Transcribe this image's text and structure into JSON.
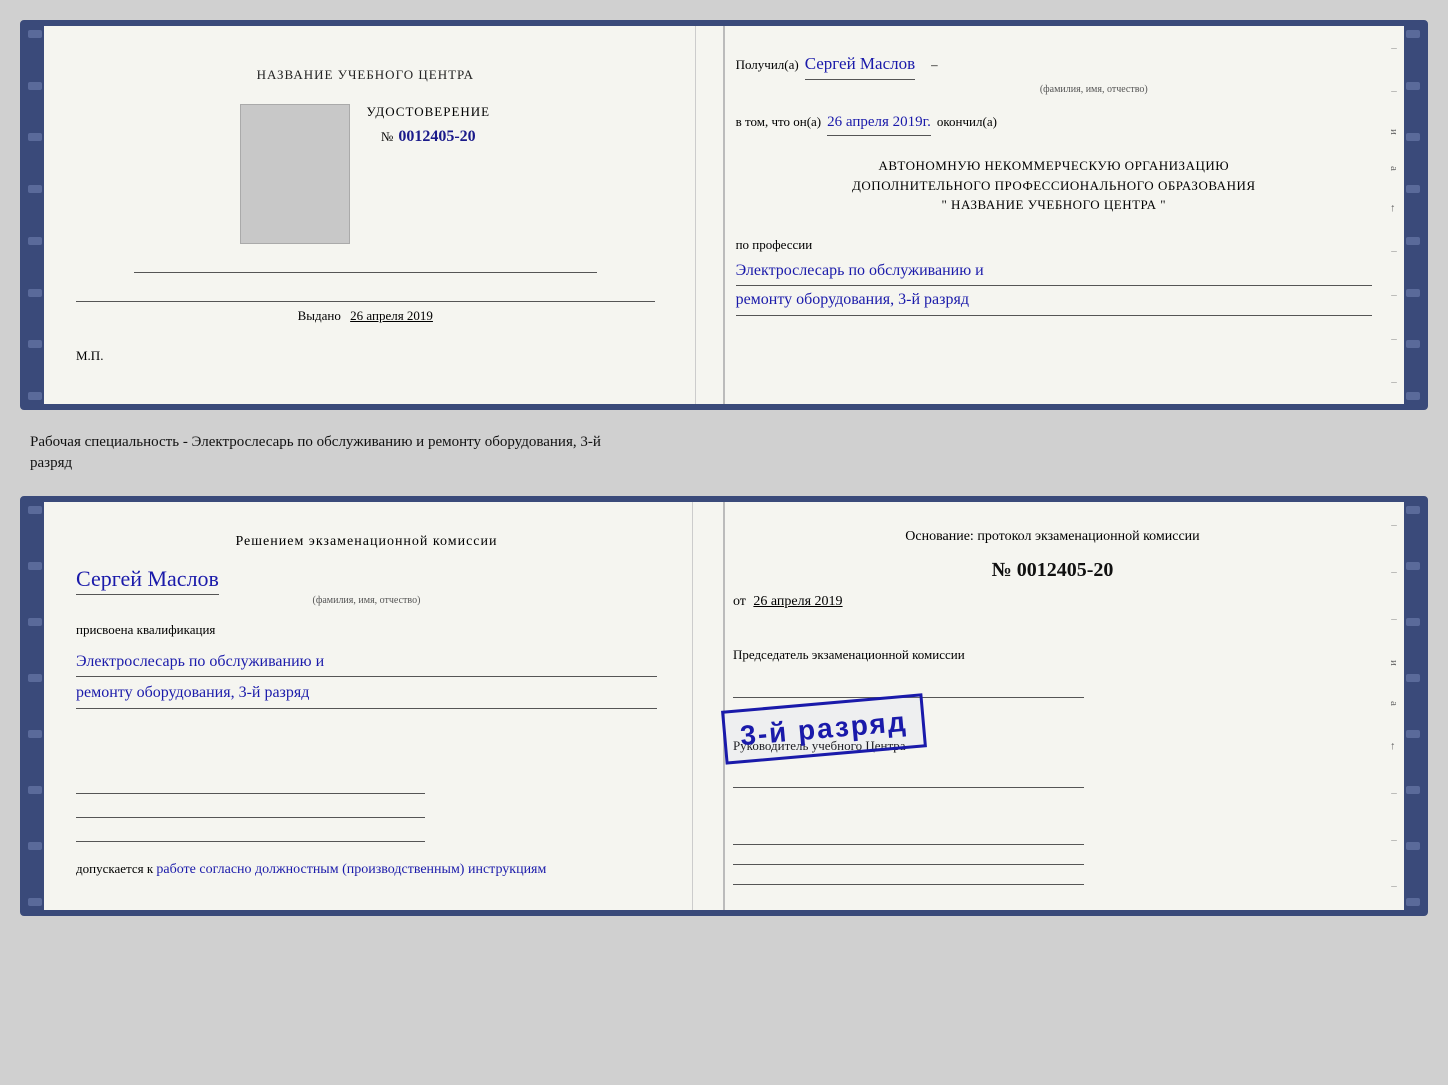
{
  "top_cert": {
    "left": {
      "training_center_label": "НАЗВАНИЕ УЧЕБНОГО ЦЕНТРА",
      "doc_type": "УДОСТОВЕРЕНИЕ",
      "doc_number_prefix": "№",
      "doc_number": "0012405-20",
      "issued_label": "Выдано",
      "issued_date": "26 апреля 2019",
      "mp_label": "М.П."
    },
    "right": {
      "received_label": "Получил(а)",
      "recipient_name": "Сергей Маслов",
      "fio_hint": "(фамилия, имя, отчество)",
      "in_that_label": "в том, что он(а)",
      "completion_date": "26 апреля 2019г.",
      "finished_label": "окончил(а)",
      "org_line1": "АВТОНОМНУЮ НЕКОММЕРЧЕСКУЮ ОРГАНИЗАЦИЮ",
      "org_line2": "ДОПОЛНИТЕЛЬНОГО ПРОФЕССИОНАЛЬНОГО ОБРАЗОВАНИЯ",
      "org_name": "\"   НАЗВАНИЕ УЧЕБНОГО ЦЕНТРА   \"",
      "profession_label": "по профессии",
      "profession_line1": "Электрослесарь по обслуживанию и",
      "profession_line2": "ремонту оборудования, 3-й разряд"
    }
  },
  "between_text": {
    "line1": "Рабочая специальность - Электрослесарь по обслуживанию и ремонту оборудования, 3-й",
    "line2": "разряд"
  },
  "bottom_cert": {
    "left": {
      "decision_title": "Решением экзаменационной комиссии",
      "person_name": "Сергей Маслов",
      "fio_hint": "(фамилия, имя, отчество)",
      "assigned_label": "присвоена квалификация",
      "qualification_line1": "Электрослесарь по обслуживанию и",
      "qualification_line2": "ремонту оборудования, 3-й разряд",
      "admits_prefix": "допускается к",
      "admits_text": "работе согласно должностным (производственным) инструкциям"
    },
    "right": {
      "basis_label": "Основание: протокол экзаменационной комиссии",
      "protocol_prefix": "№",
      "protocol_number": "0012405-20",
      "date_prefix": "от",
      "protocol_date": "26 апреля 2019",
      "chairman_label": "Председатель экзаменационной комиссии",
      "director_label": "Руководитель учебного Центра"
    },
    "stamp": {
      "text": "3-й разряд"
    }
  }
}
